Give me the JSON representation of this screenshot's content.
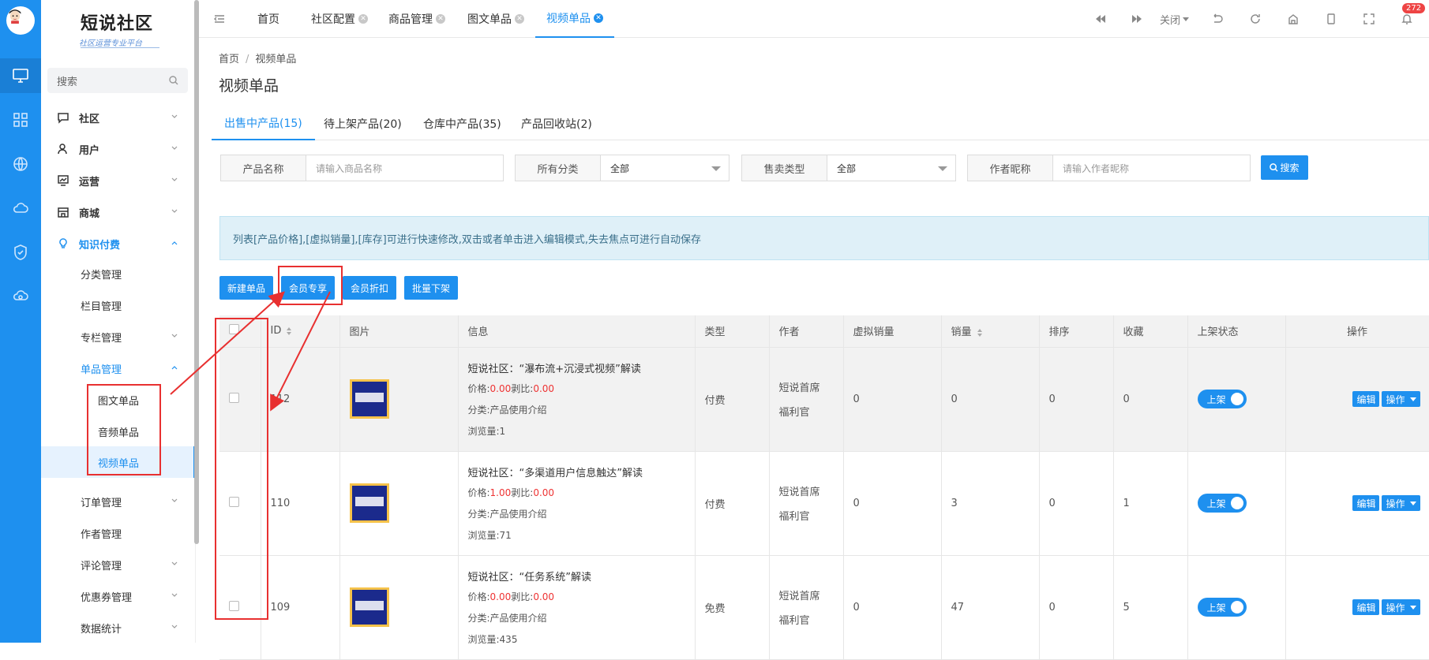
{
  "sidebar": {
    "logo": "短说社区",
    "logo_sub": "社区运营专业平台",
    "search_placeholder": "搜索",
    "menu": [
      {
        "label": "社区"
      },
      {
        "label": "用户"
      },
      {
        "label": "运营"
      },
      {
        "label": "商城"
      },
      {
        "label": "知识付费"
      },
      {
        "label": "分类管理"
      },
      {
        "label": "栏目管理"
      },
      {
        "label": "专栏管理"
      },
      {
        "label": "单品管理"
      },
      {
        "label": "图文单品"
      },
      {
        "label": "音频单品"
      },
      {
        "label": "视频单品"
      },
      {
        "label": "订单管理"
      },
      {
        "label": "作者管理"
      },
      {
        "label": "评论管理"
      },
      {
        "label": "优惠券管理"
      },
      {
        "label": "数据统计"
      }
    ]
  },
  "topbar": {
    "tabs": [
      {
        "label": "首页"
      },
      {
        "label": "社区配置"
      },
      {
        "label": "商品管理"
      },
      {
        "label": "图文单品"
      },
      {
        "label": "视频单品"
      }
    ],
    "close_label": "关闭",
    "badge": "272"
  },
  "breadcrumb": {
    "home": "首页",
    "current": "视频单品"
  },
  "page_title": "视频单品",
  "content_tabs": [
    {
      "label": "出售中产品(15)"
    },
    {
      "label": "待上架产品(20)"
    },
    {
      "label": "仓库中产品(35)"
    },
    {
      "label": "产品回收站(2)"
    }
  ],
  "filters": {
    "name_label": "产品名称",
    "name_placeholder": "请输入商品名称",
    "category_label": "所有分类",
    "category_value": "全部",
    "sale_type_label": "售卖类型",
    "sale_type_value": "全部",
    "author_label": "作者昵称",
    "author_placeholder": "请输入作者昵称",
    "search_button": "搜索"
  },
  "alert": "列表[产品价格],[虚拟销量],[库存]可进行快速修改,双击或者单击进入编辑模式,失去焦点可进行自动保存",
  "actions": [
    "新建单品",
    "会员专享",
    "会员折扣",
    "批量下架"
  ],
  "table": {
    "headers": [
      "ID",
      "图片",
      "信息",
      "类型",
      "作者",
      "虚拟销量",
      "销量",
      "排序",
      "收藏",
      "上架状态",
      "操作"
    ],
    "rows": [
      {
        "id": "112",
        "title": "短说社区：“瀑布流+沉浸式视频”解读",
        "price": "0.00",
        "ratio": "0.00",
        "category": "分类:产品使用介绍",
        "views": "浏览量:1",
        "type": "付费",
        "author1": "短说首席",
        "author2": "福利官",
        "virtual_sales": "0",
        "sales": "0",
        "sort": "0",
        "fav": "0",
        "status": "上架"
      },
      {
        "id": "110",
        "title": "短说社区：“多渠道用户信息触达”解读",
        "price": "1.00",
        "ratio": "0.00",
        "category": "分类:产品使用介绍",
        "views": "浏览量:71",
        "type": "付费",
        "author1": "短说首席",
        "author2": "福利官",
        "virtual_sales": "0",
        "sales": "3",
        "sort": "0",
        "fav": "1",
        "status": "上架"
      },
      {
        "id": "109",
        "title": "短说社区：“任务系统”解读",
        "price": "0.00",
        "ratio": "0.00",
        "category": "分类:产品使用介绍",
        "views": "浏览量:435",
        "type": "免费",
        "author1": "短说首席",
        "author2": "福利官",
        "virtual_sales": "0",
        "sales": "47",
        "sort": "0",
        "fav": "5",
        "status": "上架"
      }
    ],
    "price_label": "价格:",
    "ratio_label": "剥比:",
    "edit_label": "编辑",
    "op_label": "操作"
  },
  "colors": {
    "primary": "#1e90ef",
    "annotation": "#e83030"
  }
}
